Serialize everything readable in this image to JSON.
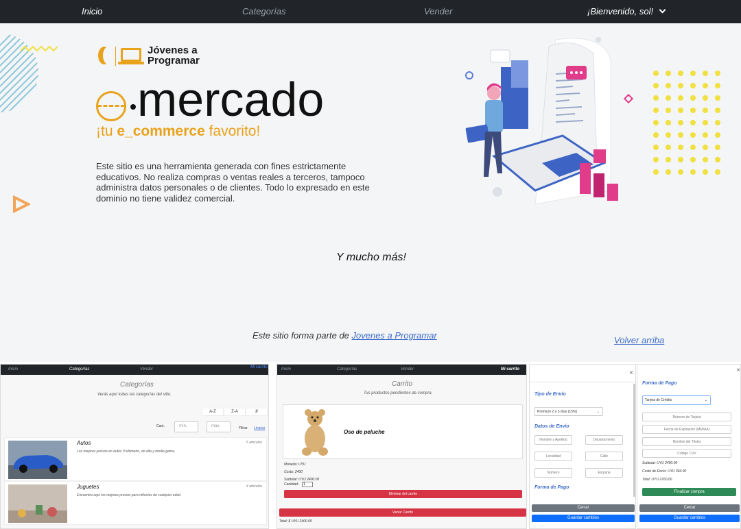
{
  "nav": {
    "home": "Inicio",
    "categories": "Categorías",
    "sell": "Vender",
    "user": "¡Bienvenido, sol!"
  },
  "logo": {
    "text": "Jóvenes a\nProgramar"
  },
  "hero": {
    "brand_word": "mercado",
    "tagline_pre": "¡tu ",
    "tagline_bold": "e_commerce",
    "tagline_post": " favorito!",
    "disclaimer": "Este sitio es una herramienta generada con fines estrictamente educativos. No realiza compras o ventas reales a terceros, tampoco administra datos personales o de clientes. Todo lo expresado en este dominio no tiene validez comercial."
  },
  "more": "Y mucho más!",
  "footer": {
    "text": "Este sitio forma parte de ",
    "link": "Jovenes a Programar",
    "back_to_top": "Volver arriba"
  },
  "colors": {
    "accent": "#e8a21b",
    "link": "#3e6cc9",
    "nav_bg": "#212529",
    "danger": "#d63345",
    "primary": "#0d6efd",
    "success": "#2e8b57"
  },
  "categories_panel": {
    "nav": {
      "home": "Inicio",
      "categories": "Categorías",
      "sell": "Vender",
      "cart": "Mi carrito"
    },
    "title": "Categorías",
    "subtitle": "Verás aquí todas las categorías del sitio.",
    "sort": {
      "asc": "A-Z",
      "desc": "Z-A",
      "count_icon": "sort-count-icon"
    },
    "count_label": "Cant.",
    "min_placeholder": "mín.",
    "max_placeholder": "máx.",
    "filter": "Filtrar",
    "clear": "Limpiar",
    "items": [
      {
        "name": "Autos",
        "desc": "Los mejores precios en autos 0 kilómetro, de alta y media gama.",
        "count": "5 artículos"
      },
      {
        "name": "Juguetes",
        "desc": "Encuentra aquí los mejores precios para niños/as de cualquier edad.",
        "count": "4 artículos"
      }
    ]
  },
  "cart_panel": {
    "nav": {
      "home": "Inicio",
      "categories": "Categorías",
      "sell": "Vender",
      "cart": "Mi carrito"
    },
    "title": "Carrito",
    "subtitle": "Tus productos pendientes de compra.",
    "product": "Oso de peluche",
    "currency": "Moneda: UYU",
    "cost": "Costo: 2400",
    "subtotal": "Subtotal: UYU 2400.00",
    "quantity_label": "Cantidad:",
    "quantity": "1",
    "remove": "Eliminar del carrito",
    "empty": "Vaciar Carrito",
    "total": "Total: $ UYU 2400.00"
  },
  "shipping_modal": {
    "shipping_type": "Tipo de Envío",
    "shipping_option": "Premium 2 a 5 días (15%)",
    "shipping_data": "Datos de Envío",
    "fields": [
      "Nombre y Apellido",
      "Departamento",
      "Localidad",
      "Calle",
      "Número",
      "Esquina"
    ],
    "payment": "Forma de Pago",
    "close": "Cerrar",
    "save": "Guardar cambios"
  },
  "payment_modal": {
    "payment": "Forma de Pago",
    "method": "Tarjeta de Crédito",
    "fields": [
      "Número de Tarjeta",
      "Fecha de Expiración (MM/AA)",
      "Nombre del Titular",
      "Código CVV"
    ],
    "subtotal": "Subtotal: UYU 2400.00",
    "shipping_cost": "Costo de Envío: UYU 360.00",
    "total": "Total: UYU 2760.00",
    "finish": "Finalizar compra",
    "close": "Cerrar",
    "save": "Guardar cambios"
  }
}
